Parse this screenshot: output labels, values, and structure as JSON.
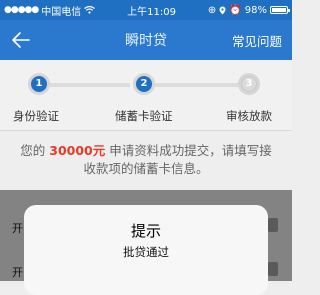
{
  "status_bar": {
    "carrier": "中国电信",
    "time": "上午11:09",
    "battery_text": "98%",
    "battery_level": 0.98
  },
  "nav": {
    "title": "瞬时贷",
    "right_link": "常见问题",
    "back_icon": "back-arrow-icon"
  },
  "steps": [
    {
      "number": "1",
      "label": "身份验证",
      "state": "done"
    },
    {
      "number": "2",
      "label": "储蓄卡验证",
      "state": "current"
    },
    {
      "number": "3",
      "label": "审核放款",
      "state": "pending"
    }
  ],
  "message": {
    "prefix": "您的",
    "amount": "30000元",
    "line1_rest": "申请资料成功提交，请填写接",
    "line2": "收款项的储蓄卡信息。"
  },
  "background_rows": [
    {
      "label": "开"
    },
    {
      "label": "开"
    }
  ],
  "dialog": {
    "title": "提示",
    "message": "批贷通过"
  },
  "colors": {
    "nav_bg": "#2b79cf",
    "status_bg": "#1f6fc3",
    "accent_amount": "#e53b2a",
    "step_active": "#1f6fc3"
  }
}
